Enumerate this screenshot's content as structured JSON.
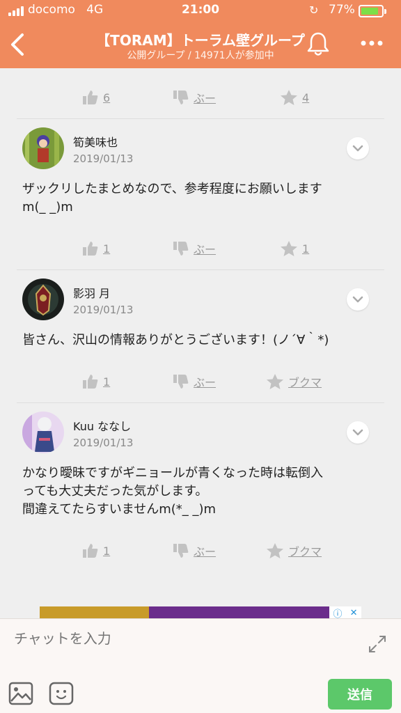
{
  "status_bar": {
    "carrier": "docomo",
    "network": "4G",
    "time": "21:00",
    "battery_percent": "77%",
    "battery_level": 0.77
  },
  "header": {
    "title": "【TORAM】トーラム壁グループ",
    "subtitle": "公開グループ / 14971人が参加中"
  },
  "top_actions": {
    "likes": "6",
    "boo_label": "ぶー",
    "favorites": "4"
  },
  "posts": [
    {
      "author": "筍美味也",
      "date": "2019/01/13",
      "body": "ザックリしたまとめなので、参考程度にお願いします\nm(_ _)m",
      "likes": "1",
      "boo_label": "ぶー",
      "third_label": "1"
    },
    {
      "author": "影羽 月",
      "date": "2019/01/13",
      "body": "皆さん、沢山の情報ありがとうございます！(ノ´∀｀*)",
      "likes": "1",
      "boo_label": "ぶー",
      "third_label": "ブクマ"
    },
    {
      "author": "Kuu ななし",
      "date": "2019/01/13",
      "body": "かなり曖昧ですがギニョールが青くなった時は転倒入\nっても大丈夫だった気がします。\n間違えてたらすいませんm(*_ _)m",
      "likes": "1",
      "boo_label": "ぶー",
      "third_label": "ブクマ"
    }
  ],
  "input": {
    "placeholder": "チャットを入力",
    "send_label": "送信"
  },
  "icons": {
    "back": "chevron-left-icon",
    "bell": "bell-icon",
    "more": "more-dots-icon",
    "like": "thumbs-up-icon",
    "dislike": "thumbs-down-icon",
    "star": "star-icon",
    "expand": "chevron-down-icon",
    "fullscreen": "expand-arrows-icon",
    "image": "image-icon",
    "stamp": "emoji-icon"
  },
  "colors": {
    "header": "#f08a5d",
    "send": "#5cc86a",
    "battery": "#7dde49"
  }
}
